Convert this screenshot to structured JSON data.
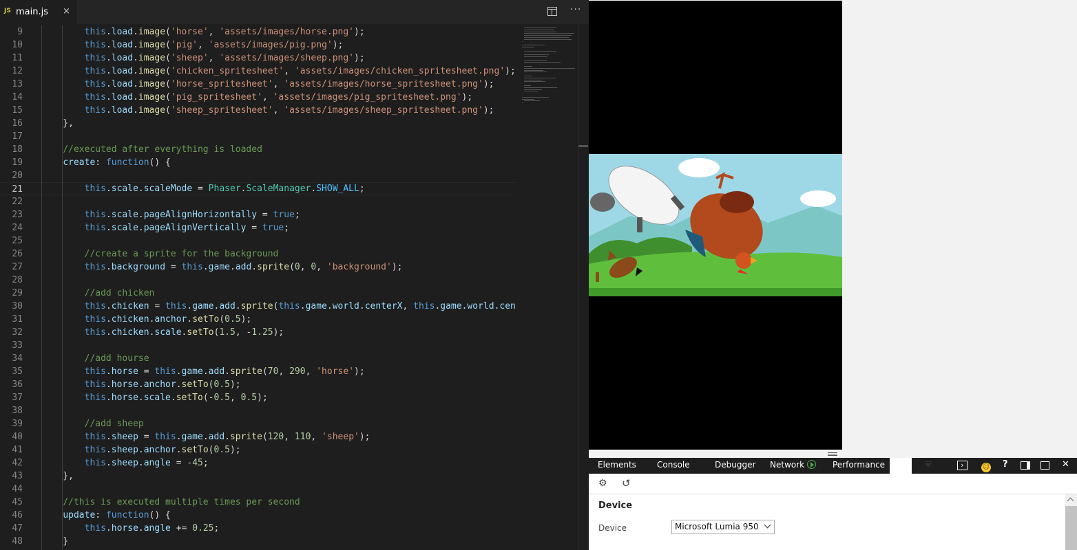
{
  "editor": {
    "tab": {
      "icon": "JS",
      "filename": "main.js",
      "close": "×"
    },
    "actions": {
      "more": "···"
    },
    "lines": [
      {
        "n": 9,
        "text": "        this.load.image('horse', 'assets/images/horse.png');"
      },
      {
        "n": 10,
        "text": "        this.load.image('pig', 'assets/images/pig.png');"
      },
      {
        "n": 11,
        "text": "        this.load.image('sheep', 'assets/images/sheep.png');"
      },
      {
        "n": 12,
        "text": "        this.load.image('chicken_spritesheet', 'assets/images/chicken_spritesheet.png');"
      },
      {
        "n": 13,
        "text": "        this.load.image('horse_spritesheet', 'assets/images/horse_spritesheet.png');"
      },
      {
        "n": 14,
        "text": "        this.load.image('pig_spritesheet', 'assets/images/pig_spritesheet.png');"
      },
      {
        "n": 15,
        "text": "        this.load.image('sheep_spritesheet', 'assets/images/sheep_spritesheet.png');"
      },
      {
        "n": 16,
        "text": "    },"
      },
      {
        "n": 17,
        "text": ""
      },
      {
        "n": 18,
        "text": "    //executed after everything is loaded"
      },
      {
        "n": 19,
        "text": "    create: function() {"
      },
      {
        "n": 20,
        "text": ""
      },
      {
        "n": 21,
        "text": "        this.scale.scaleMode = Phaser.ScaleManager.SHOW_ALL;"
      },
      {
        "n": 22,
        "text": ""
      },
      {
        "n": 23,
        "text": "        this.scale.pageAlignHorizontally = true;"
      },
      {
        "n": 24,
        "text": "        this.scale.pageAlignVertically = true;"
      },
      {
        "n": 25,
        "text": ""
      },
      {
        "n": 26,
        "text": "        //create a sprite for the background"
      },
      {
        "n": 27,
        "text": "        this.background = this.game.add.sprite(0, 0, 'background');"
      },
      {
        "n": 28,
        "text": ""
      },
      {
        "n": 29,
        "text": "        //add chicken"
      },
      {
        "n": 30,
        "text": "        this.chicken = this.game.add.sprite(this.game.world.centerX, this.game.world.cente"
      },
      {
        "n": 31,
        "text": "        this.chicken.anchor.setTo(0.5);"
      },
      {
        "n": 32,
        "text": "        this.chicken.scale.setTo(1.5, -1.25);"
      },
      {
        "n": 33,
        "text": ""
      },
      {
        "n": 34,
        "text": "        //add hourse"
      },
      {
        "n": 35,
        "text": "        this.horse = this.game.add.sprite(70, 290, 'horse');"
      },
      {
        "n": 36,
        "text": "        this.horse.anchor.setTo(0.5);"
      },
      {
        "n": 37,
        "text": "        this.horse.scale.setTo(-0.5, 0.5);"
      },
      {
        "n": 38,
        "text": ""
      },
      {
        "n": 39,
        "text": "        //add sheep"
      },
      {
        "n": 40,
        "text": "        this.sheep = this.game.add.sprite(120, 110, 'sheep');"
      },
      {
        "n": 41,
        "text": "        this.sheep.anchor.setTo(0.5);"
      },
      {
        "n": 42,
        "text": "        this.sheep.angle = -45;"
      },
      {
        "n": 43,
        "text": "    },"
      },
      {
        "n": 44,
        "text": ""
      },
      {
        "n": 45,
        "text": "    //this is executed multiple times per second"
      },
      {
        "n": 46,
        "text": "    update: function() {"
      },
      {
        "n": 47,
        "text": "        this.horse.angle += 0.25;"
      },
      {
        "n": 48,
        "text": "    }"
      }
    ],
    "current_line": 21,
    "colors": {
      "keyword": "#569cd6",
      "string": "#ce9178",
      "comment": "#6a9955",
      "number": "#b5cea8",
      "method": "#dcdcaa",
      "property": "#9cdcfe",
      "class": "#4ec9b0",
      "constant": "#4fc1ff"
    }
  },
  "devtools": {
    "tabs": [
      "Elements",
      "Console",
      "Debugger",
      "Network",
      "Performance"
    ],
    "section_title": "Device",
    "device_label": "Device",
    "device_value": "Microsoft Lumia 950",
    "help": "?",
    "close": "✕"
  }
}
